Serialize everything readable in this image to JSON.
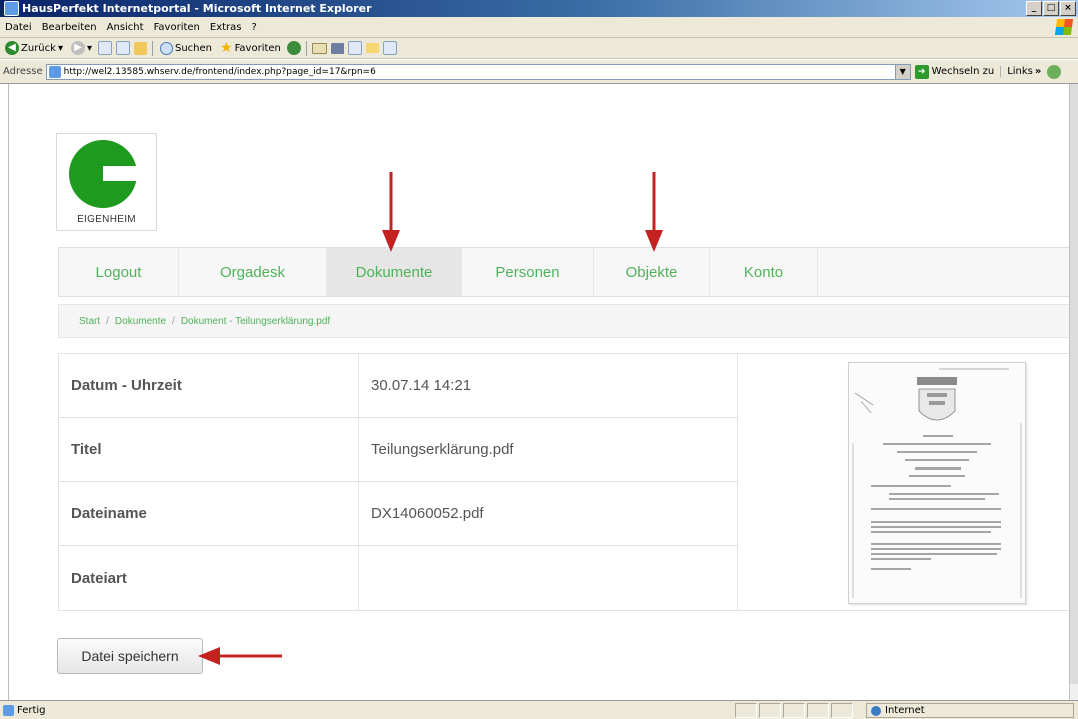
{
  "window": {
    "title": "HausPerfekt Internetportal - Microsoft Internet Explorer"
  },
  "menubar": {
    "items": [
      "Datei",
      "Bearbeiten",
      "Ansicht",
      "Favoriten",
      "Extras",
      "?"
    ]
  },
  "toolbar": {
    "back_label": "Zurück",
    "search_label": "Suchen",
    "favorites_label": "Favoriten"
  },
  "addressbar": {
    "label": "Adresse",
    "url": "http://wel2.13585.whserv.de/frontend/index.php?page_id=17&rpn=6",
    "go_label": "Wechseln zu",
    "links_label": "Links",
    "links_more": "»"
  },
  "logo": {
    "text": "EIGENHEIM",
    "color": "#1e9b1e"
  },
  "nav": {
    "items": [
      {
        "label": "Logout",
        "active": false
      },
      {
        "label": "Orgadesk",
        "active": false
      },
      {
        "label": "Dokumente",
        "active": true
      },
      {
        "label": "Personen",
        "active": false
      },
      {
        "label": "Objekte",
        "active": false
      },
      {
        "label": "Konto",
        "active": false
      }
    ]
  },
  "breadcrumb": {
    "items": [
      "Start",
      "Dokumente",
      "Dokument - Teilungserklärung.pdf"
    ],
    "separator": "/"
  },
  "document": {
    "rows": [
      {
        "label": "Datum - Uhrzeit",
        "value": "30.07.14 14:21"
      },
      {
        "label": "Titel",
        "value": "Teilungserklärung.pdf"
      },
      {
        "label": "Dateiname",
        "value": "DX14060052.pdf"
      },
      {
        "label": "Dateiart",
        "value": ""
      }
    ]
  },
  "actions": {
    "save_label": "Datei speichern"
  },
  "statusbar": {
    "left": "Fertig",
    "zone": "Internet"
  },
  "colors": {
    "accent_green": "#4fb25a",
    "annotation_red": "#c42121"
  }
}
